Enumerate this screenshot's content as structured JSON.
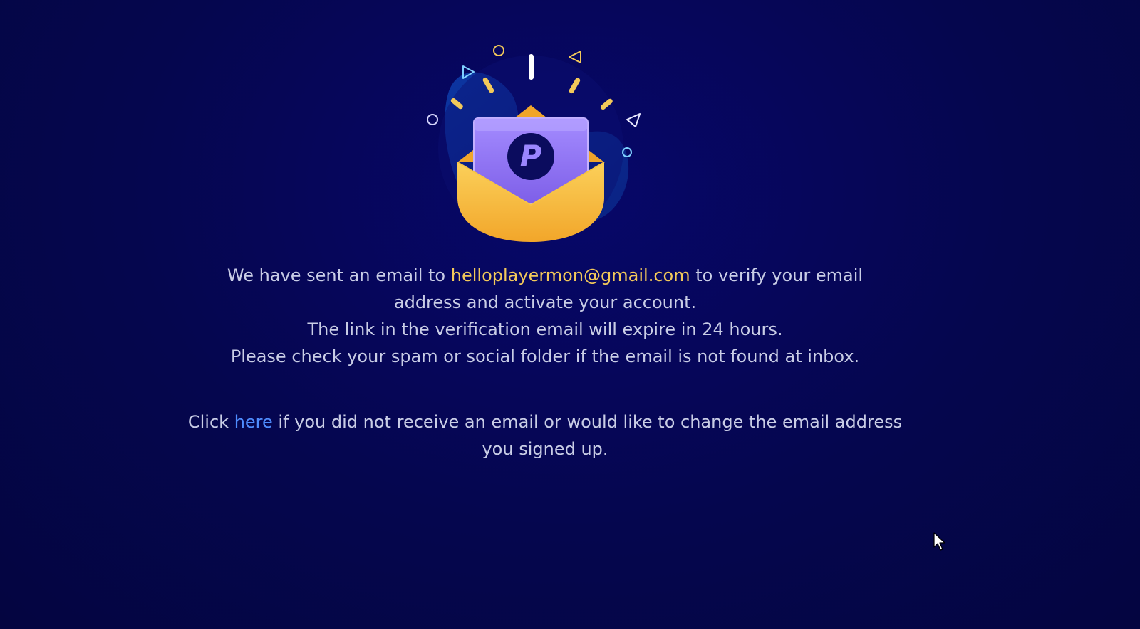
{
  "illustration": {
    "icon": "mail-sent-illustration",
    "logo_letter": "P"
  },
  "message": {
    "line1_before_email": "We have sent an email to ",
    "email": "helloplayermon@gmail.com",
    "line1_after_email": " to verify your email",
    "line2": "address and activate your account.",
    "line3": "The link in the verification email will expire in 24 hours.",
    "line4": "Please check your spam or social folder if the email is not found at inbox."
  },
  "resend": {
    "before_link": "Click ",
    "link_label": "here",
    "after_link": " if you did not receive an email or would like to change the email address",
    "line2": "you signed up."
  },
  "colors": {
    "background": "#05064a",
    "text": "#c9cde6",
    "email_highlight": "#f3c95a",
    "link": "#4f8dff",
    "envelope": "#f5b93a",
    "card": "#8a6cf0"
  }
}
